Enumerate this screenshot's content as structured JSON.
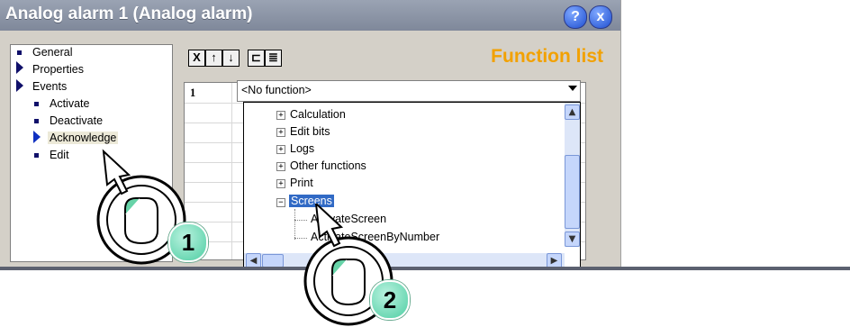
{
  "window": {
    "title": "Analog alarm 1 (Analog alarm)",
    "help_glyph": "?",
    "close_glyph": "x"
  },
  "tree": {
    "items": [
      {
        "label": "General"
      },
      {
        "label": "Properties"
      },
      {
        "label": "Events"
      },
      {
        "label": "Activate"
      },
      {
        "label": "Deactivate"
      },
      {
        "label": "Acknowledge"
      },
      {
        "label": "Edit"
      }
    ]
  },
  "toolbar": {
    "delete_glyph": "X",
    "up_glyph": "↑",
    "down_glyph": "↓",
    "icon1_glyph": "⊏",
    "icon2_glyph": "≣"
  },
  "function_list": {
    "title": "Function list",
    "row_number": "1",
    "selected_value": "<No function>"
  },
  "dropdown_list": {
    "items": [
      {
        "label": "Calculation",
        "expander": "+"
      },
      {
        "label": "Edit bits",
        "expander": "+"
      },
      {
        "label": "Logs",
        "expander": "+"
      },
      {
        "label": "Other functions",
        "expander": "+"
      },
      {
        "label": "Print",
        "expander": "+"
      },
      {
        "label": "Screens",
        "expander": "−"
      }
    ],
    "children": [
      {
        "label": "ActivateScreen"
      },
      {
        "label": "ActivateScreenByNumber"
      }
    ]
  },
  "badges": {
    "step1": "1",
    "step2": "2"
  },
  "colors": {
    "accent_orange": "#f2a100",
    "selection_blue": "#316ac5",
    "badge_green": "#4fcea3"
  }
}
